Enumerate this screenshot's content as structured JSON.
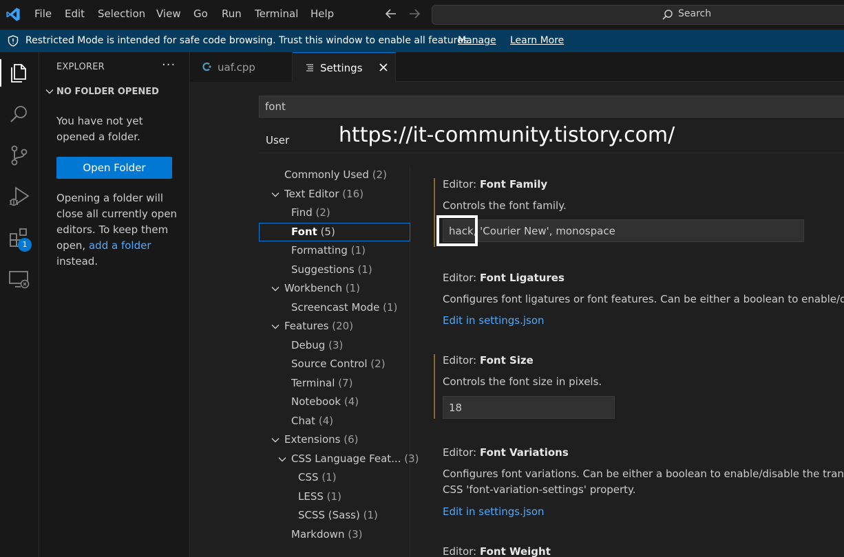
{
  "menu": {
    "items": [
      "File",
      "Edit",
      "Selection",
      "View",
      "Go",
      "Run",
      "Terminal",
      "Help"
    ]
  },
  "titlebar": {
    "search_label": "Search"
  },
  "banner": {
    "text": "Restricted Mode is intended for safe code browsing. Trust this window to enable all features.",
    "manage": "Manage",
    "learn_more": "Learn More"
  },
  "activity": {
    "extensions_badge": "1"
  },
  "sidebar": {
    "title": "EXPLORER",
    "more": "···",
    "section": "NO FOLDER OPENED",
    "message": "You have not yet opened a folder.",
    "open_folder": "Open Folder",
    "message2_pre": "Opening a folder will close all currently open editors. To keep them open, ",
    "message2_link": "add a folder",
    "message2_post": " instead."
  },
  "tabs": [
    {
      "label": "uaf.cpp",
      "icon": "cpp-file-icon"
    },
    {
      "label": "Settings",
      "icon": "settings-list-icon"
    }
  ],
  "settings": {
    "search_value": "font",
    "scope_tab": "User",
    "watermark": "https://it-community.tistory.com/",
    "toc": [
      {
        "label": "Commonly Used",
        "count": "(2)"
      },
      {
        "label": "Text Editor",
        "count": "(16)"
      },
      {
        "label": "Find",
        "count": "(2)"
      },
      {
        "label": "Font",
        "count": "(5)"
      },
      {
        "label": "Formatting",
        "count": "(1)"
      },
      {
        "label": "Suggestions",
        "count": "(1)"
      },
      {
        "label": "Workbench",
        "count": "(1)"
      },
      {
        "label": "Screencast Mode",
        "count": "(1)"
      },
      {
        "label": "Features",
        "count": "(20)"
      },
      {
        "label": "Debug",
        "count": "(3)"
      },
      {
        "label": "Source Control",
        "count": "(2)"
      },
      {
        "label": "Terminal",
        "count": "(7)"
      },
      {
        "label": "Notebook",
        "count": "(4)"
      },
      {
        "label": "Chat",
        "count": "(4)"
      },
      {
        "label": "Extensions",
        "count": "(6)"
      },
      {
        "label": "CSS Language Feat...",
        "count": "(3)"
      },
      {
        "label": "CSS",
        "count": "(1)"
      },
      {
        "label": "LESS",
        "count": "(1)"
      },
      {
        "label": "SCSS (Sass)",
        "count": "(1)"
      },
      {
        "label": "Markdown",
        "count": "(3)"
      }
    ],
    "items": [
      {
        "category": "Editor: ",
        "name": "Font Family",
        "description": "Controls the font family.",
        "value": "hack, 'Courier New', monospace"
      },
      {
        "category": "Editor: ",
        "name": "Font Ligatures",
        "description": "Configures font ligatures or font features. Can be either a boolean to enable/disable ligatures or a string for the value of the CSS 'font-feature-settings' property.",
        "link": "Edit in settings.json"
      },
      {
        "category": "Editor: ",
        "name": "Font Size",
        "description": "Controls the font size in pixels.",
        "value": "18"
      },
      {
        "category": "Editor: ",
        "name": "Font Variations",
        "description": "Configures font variations. Can be either a boolean to enable/disable the translation from font-weight to font-variation-settings or a string for the value of the",
        "description2": "CSS 'font-variation-settings' property.",
        "link": "Edit in settings.json"
      },
      {
        "category": "Editor: ",
        "name": "Font Weight"
      }
    ]
  },
  "colors": {
    "accent": "#0078d4",
    "banner": "#063b60",
    "link": "#4daafc",
    "modified_bar": "#8a6a2a"
  }
}
